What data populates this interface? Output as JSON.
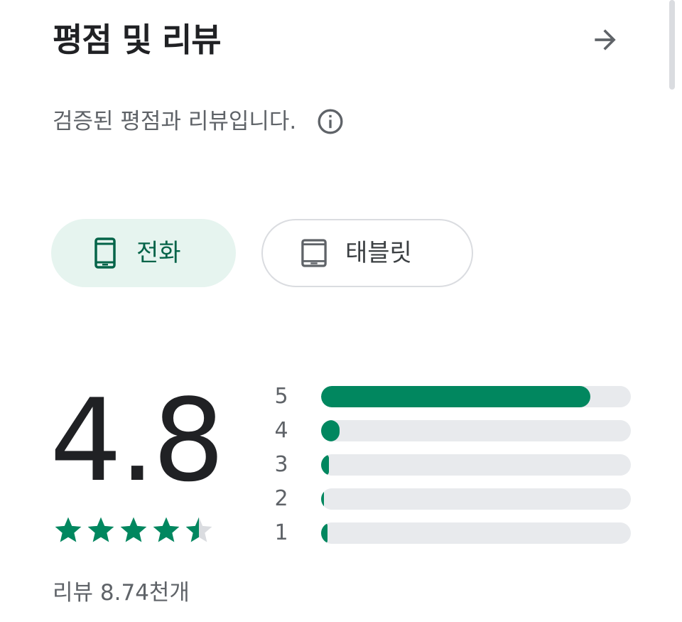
{
  "header": {
    "title": "평점 및 리뷰",
    "arrow_icon": "arrow-forward-icon"
  },
  "subtitle": {
    "text": "검증된 평점과 리뷰입니다.",
    "info_icon": "info-icon"
  },
  "device_chips": [
    {
      "label": "전화",
      "icon": "smartphone-icon",
      "selected": true
    },
    {
      "label": "태블릿",
      "icon": "tablet-icon",
      "selected": false
    }
  ],
  "rating": {
    "score": "4.8",
    "stars_filled": 4.5,
    "stars_total": 5,
    "review_count": "리뷰 8.74천개"
  },
  "distribution": [
    {
      "stars": "5",
      "fraction": 0.87
    },
    {
      "stars": "4",
      "fraction": 0.06
    },
    {
      "stars": "3",
      "fraction": 0.025
    },
    {
      "stars": "2",
      "fraction": 0.008
    },
    {
      "stars": "1",
      "fraction": 0.02
    }
  ],
  "colors": {
    "accent": "#01875f",
    "chip_selected_bg": "#e6f4ef",
    "chip_selected_text": "#056449",
    "track": "#e8eaed",
    "text_primary": "#202124",
    "text_secondary": "#5f6368"
  }
}
